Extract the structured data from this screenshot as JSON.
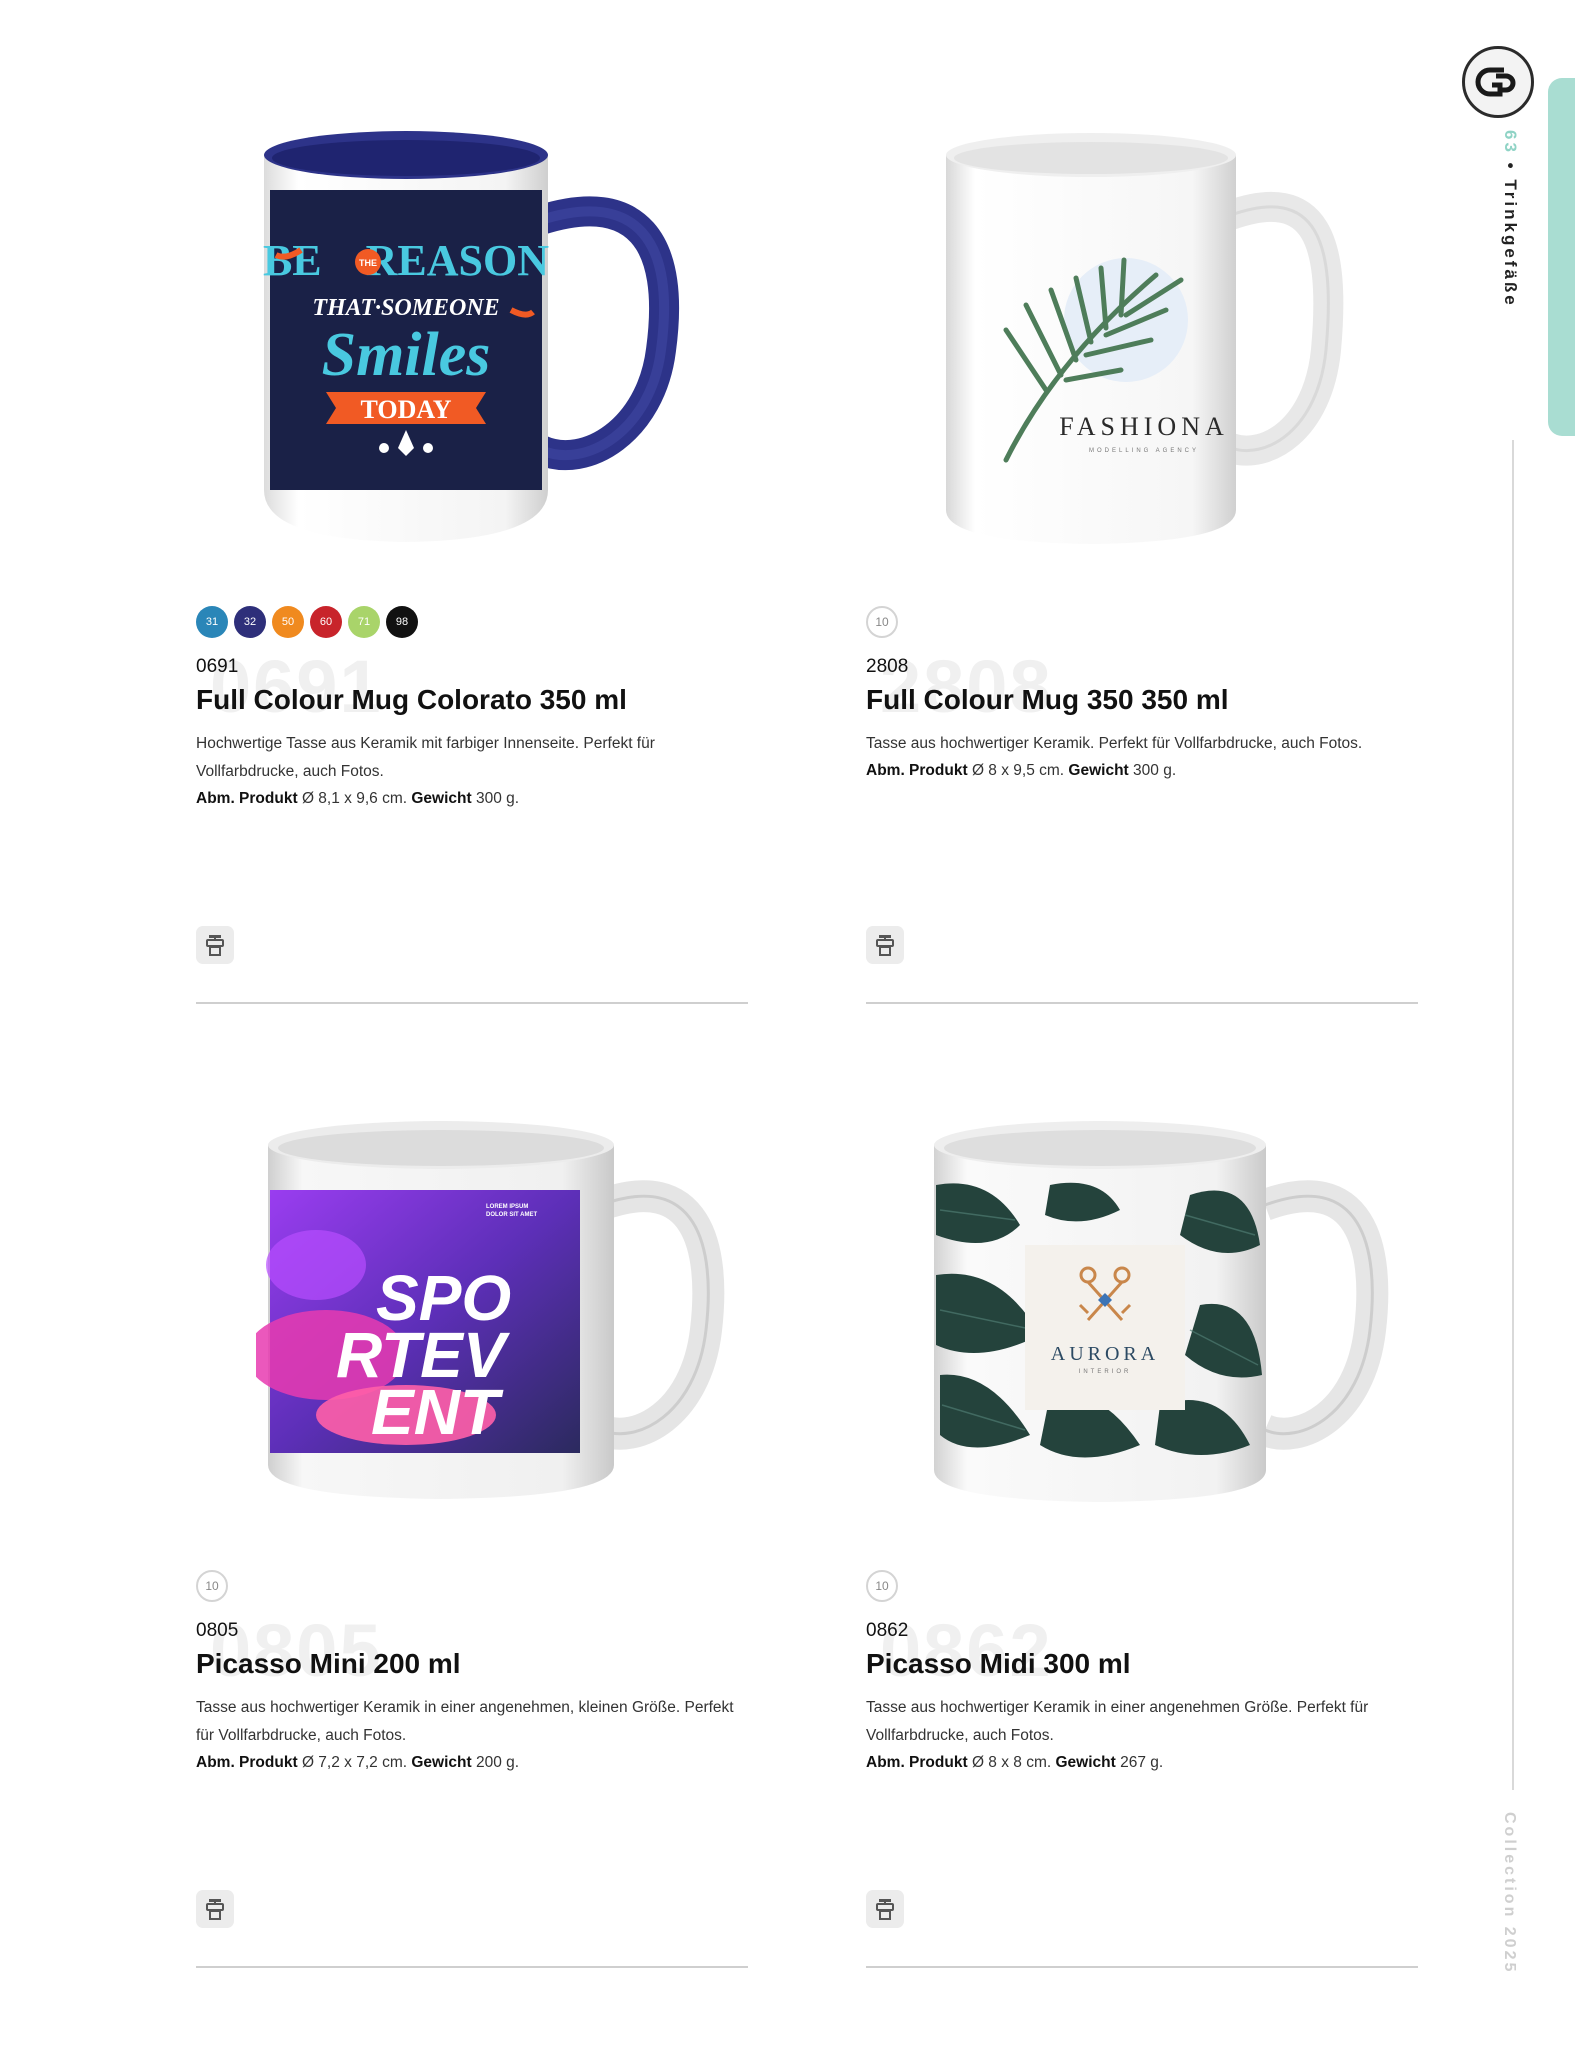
{
  "sidebar": {
    "page_number": "63",
    "section": "Trinkgefäße",
    "bullet": "•",
    "collection": "Collection 2025"
  },
  "colors": {
    "accent_tab": "#a9ddd2",
    "page_number_color": "#8fd3c5"
  },
  "products": [
    {
      "code": "0691",
      "title": "Full Colour Mug Colorato 350 ml",
      "description": "Hochwertige Tasse aus Keramik mit farbiger Innenseite. Perfekt für Vollfarbdrucke, auch Fotos.",
      "spec_dims_label": "Abm. Produkt",
      "spec_dims": "Ø 8,1 x 9,6 cm.",
      "spec_weight_label": "Gewicht",
      "spec_weight": "300 g.",
      "swatches": [
        {
          "label": "31",
          "color": "#2a86b8"
        },
        {
          "label": "32",
          "color": "#2e2f7a"
        },
        {
          "label": "50",
          "color": "#f08a1f"
        },
        {
          "label": "60",
          "color": "#c8242b"
        },
        {
          "label": "71",
          "color": "#a9d46a"
        },
        {
          "label": "98",
          "color": "#111111"
        }
      ],
      "mug_art": {
        "line1": "BE",
        "the": "THE",
        "line1b": "REASON",
        "line2": "THAT SOMEONE",
        "line3": "Smiles",
        "line4": "TODAY"
      }
    },
    {
      "code": "2808",
      "title": "Full Colour Mug 350 350 ml",
      "description": "Tasse aus hochwertiger Keramik. Perfekt für Vollfarbdrucke, auch Fotos.",
      "spec_dims_label": "Abm. Produkt",
      "spec_dims": "Ø 8 x 9,5 cm.",
      "spec_weight_label": "Gewicht",
      "spec_weight": "300 g.",
      "qty": "10",
      "mug_art": {
        "brand": "FASHIONA",
        "tagline": "MODELLING AGENCY"
      }
    },
    {
      "code": "0805",
      "title": "Picasso Mini 200 ml",
      "description": "Tasse aus hochwertiger Keramik in einer angenehmen, kleinen Größe. Perfekt für Vollfarbdrucke, auch Fotos.",
      "spec_dims_label": "Abm. Produkt",
      "spec_dims": "Ø 7,2 x 7,2 cm.",
      "spec_weight_label": "Gewicht",
      "spec_weight": "200 g.",
      "qty": "10",
      "mug_art": {
        "l1": "SPO",
        "l2": "RTEV",
        "l3": "ENT",
        "small1": "LOREM IPSUM",
        "small2": "DOLOR SIT AMET"
      }
    },
    {
      "code": "0862",
      "title": "Picasso Midi 300 ml",
      "description": "Tasse aus hochwertiger Keramik in einer angenehmen Größe. Perfekt für Vollfarbdrucke, auch Fotos.",
      "spec_dims_label": "Abm. Produkt",
      "spec_dims": "Ø 8 x 8 cm.",
      "spec_weight_label": "Gewicht",
      "spec_weight": "267 g.",
      "qty": "10",
      "mug_art": {
        "brand": "AURORA",
        "tagline": "INTERIOR"
      }
    }
  ]
}
